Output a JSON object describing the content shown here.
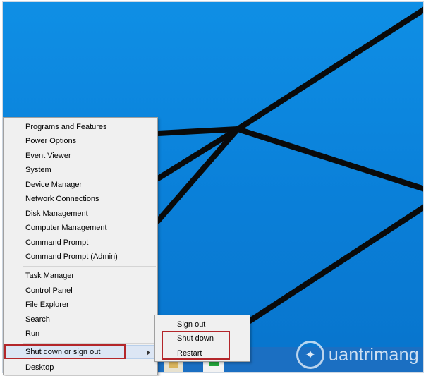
{
  "context_menu": {
    "group1": [
      "Programs and Features",
      "Power Options",
      "Event Viewer",
      "System",
      "Device Manager",
      "Network Connections",
      "Disk Management",
      "Computer Management",
      "Command Prompt",
      "Command Prompt (Admin)"
    ],
    "group2": [
      "Task Manager",
      "Control Panel",
      "File Explorer",
      "Search",
      "Run"
    ],
    "shutdown_item": "Shut down or sign out",
    "desktop_item": "Desktop"
  },
  "submenu": {
    "items": [
      "Sign out",
      "Shut down",
      "Restart"
    ]
  },
  "watermark": {
    "text": "uantrimang"
  },
  "taskbar": {
    "icons": [
      "file-explorer-icon",
      "store-icon"
    ]
  },
  "colors": {
    "desktop_blue": "#0a7fd8",
    "highlight_red": "#b3262a",
    "menu_bg": "#f0f0f0"
  }
}
